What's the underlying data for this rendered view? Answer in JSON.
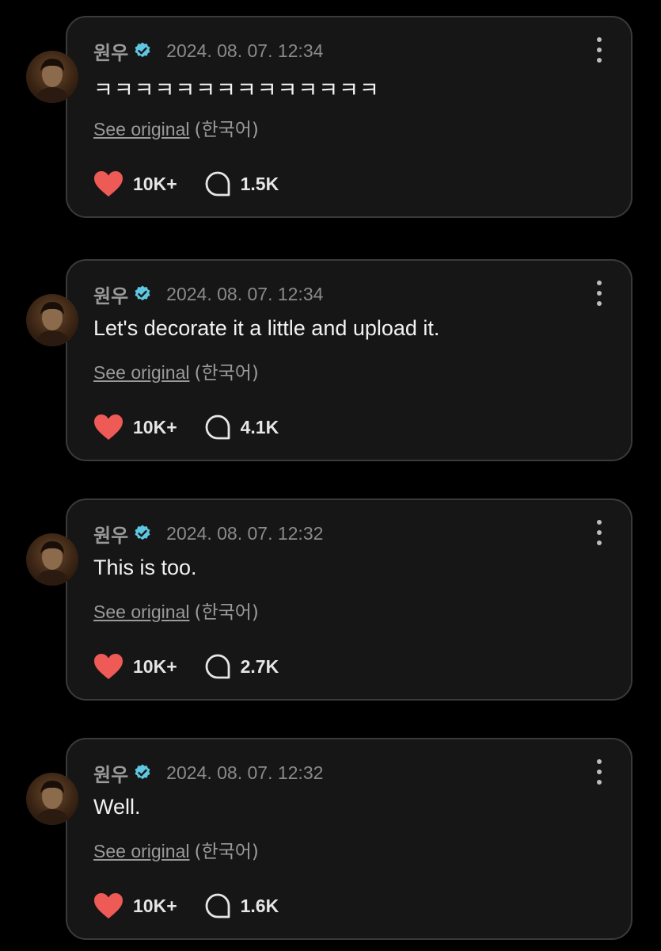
{
  "colors": {
    "background": "#000000",
    "card": "#161616",
    "card_border": "#3a3a3a",
    "heart": "#ee5a55",
    "verified": "#5ec6e0"
  },
  "posts": [
    {
      "author": "원우",
      "timestamp": "2024. 08. 07. 12:34",
      "text": "ㅋㅋㅋㅋㅋㅋㅋㅋㅋㅋㅋㅋㅋㅋ",
      "see_original": "See original",
      "language": "(한국어)",
      "likes": "10K+",
      "comments": "1.5K"
    },
    {
      "author": "원우",
      "timestamp": "2024. 08. 07. 12:34",
      "text": "Let's decorate it a little and upload it.",
      "see_original": "See original",
      "language": "(한국어)",
      "likes": "10K+",
      "comments": "4.1K"
    },
    {
      "author": "원우",
      "timestamp": "2024. 08. 07. 12:32",
      "text": "This is too.",
      "see_original": "See original",
      "language": "(한국어)",
      "likes": "10K+",
      "comments": "2.7K"
    },
    {
      "author": "원우",
      "timestamp": "2024. 08. 07. 12:32",
      "text": "Well.",
      "see_original": "See original",
      "language": "(한국어)",
      "likes": "10K+",
      "comments": "1.6K"
    }
  ]
}
